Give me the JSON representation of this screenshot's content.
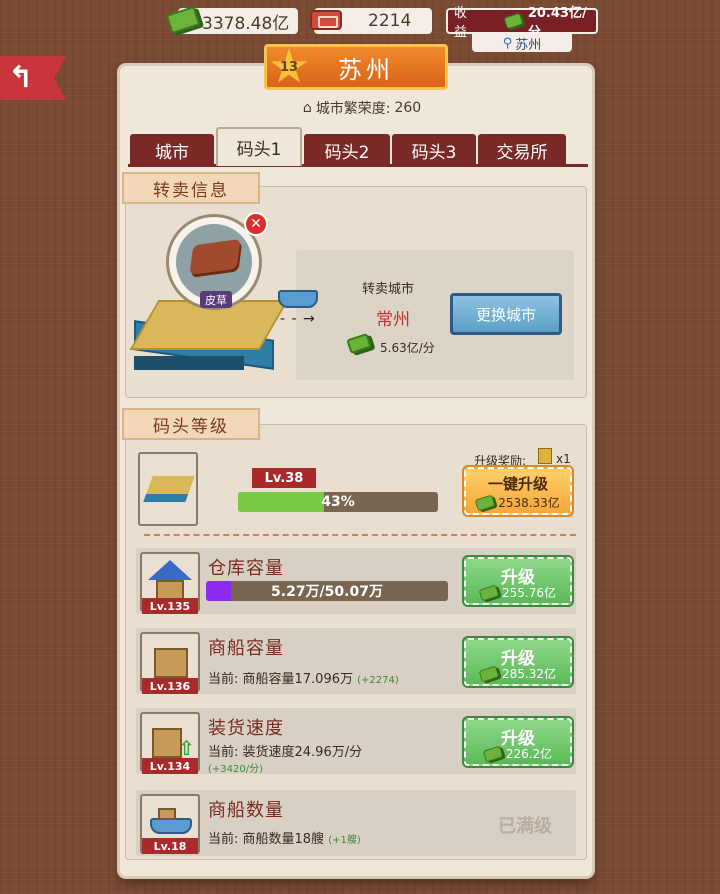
{
  "topbar": {
    "gold": "3378.48亿",
    "ships": "2214",
    "income_label": "收益",
    "income_value": "20.43亿/分",
    "location": "苏州"
  },
  "city": {
    "level": "13",
    "name": "苏州",
    "prosperity_label": "城市繁荣度:",
    "prosperity_value": "260"
  },
  "tabs": [
    {
      "label": "城市",
      "active": false
    },
    {
      "label": "码头1",
      "active": true
    },
    {
      "label": "码头2",
      "active": false
    },
    {
      "label": "码头3",
      "active": false
    },
    {
      "label": "交易所",
      "active": false
    }
  ],
  "resell": {
    "section_title": "转卖信息",
    "item_label": "皮草",
    "city_label": "转卖城市",
    "city_name": "常州",
    "rate": "5.63亿/分",
    "change_button": "更换城市"
  },
  "dock_level": {
    "section_title": "码头等级",
    "level": "Lv.38",
    "progress_text": "43%",
    "progress": 0.43,
    "reward_label": "升级奖励:",
    "reward_count": "x1",
    "upgrade_label": "一键升级",
    "upgrade_cost": "2538.33亿"
  },
  "upgrades": [
    {
      "title": "仓库容量",
      "level": "Lv.135",
      "bar_text": "5.27万/50.07万",
      "bar_progress": 0.105,
      "button": "升级",
      "cost": "255.76亿"
    },
    {
      "title": "商船容量",
      "level": "Lv.136",
      "sub": "当前: 商船容量17.096万",
      "inc": "(+2274)",
      "button": "升级",
      "cost": "285.32亿"
    },
    {
      "title": "装货速度",
      "level": "Lv.134",
      "sub": "当前: 装货速度24.96万/分",
      "inc": "(+3420/分)",
      "button": "升级",
      "cost": "226.2亿"
    },
    {
      "title": "商船数量",
      "level": "Lv.18",
      "sub": "当前: 商船数量18艘",
      "inc": "(+1艘)",
      "maxed": "已满级"
    }
  ],
  "colors": {
    "background": "#7a4a33",
    "tab": "#7a2a26",
    "accent_orange": "#f08a2c",
    "green_button": "#5aba56",
    "progress_green": "#7ac943",
    "progress_purple": "#8a2cf0"
  }
}
